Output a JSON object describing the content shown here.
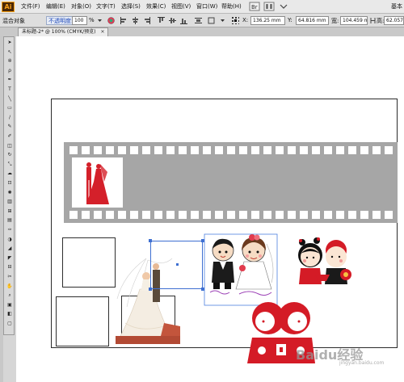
{
  "app": {
    "logo_text": "Ai",
    "brand_color": "#f7a11a"
  },
  "menu": {
    "items": [
      {
        "label": "文件(F)"
      },
      {
        "label": "编辑(E)"
      },
      {
        "label": "对象(O)"
      },
      {
        "label": "文字(T)"
      },
      {
        "label": "选择(S)"
      },
      {
        "label": "效果(C)"
      },
      {
        "label": "视图(V)"
      },
      {
        "label": "窗口(W)"
      },
      {
        "label": "帮助(H)"
      }
    ],
    "right_label": "基本"
  },
  "control_bar": {
    "group_label": "混合对象",
    "opacity_label": "不透明度:",
    "opacity_value": "100",
    "opacity_unit": "%",
    "x_label": "X:",
    "x_value": "136.25 mm",
    "y_label": "Y:",
    "y_value": "64.816 mm",
    "w_label": "宽:",
    "w_value": "104.459 m",
    "h_label": "高:",
    "h_value": "62.057 mm"
  },
  "document": {
    "tab_label": "未标题-2* @ 100% (CMYK/预览)"
  },
  "toolbox": {
    "tools": [
      {
        "name": "selection-tool-icon",
        "glyph": "➤"
      },
      {
        "name": "direct-selection-tool-icon",
        "glyph": "↖"
      },
      {
        "name": "magic-wand-tool-icon",
        "glyph": "✲"
      },
      {
        "name": "lasso-tool-icon",
        "glyph": "ρ"
      },
      {
        "name": "pen-tool-icon",
        "glyph": "✒"
      },
      {
        "name": "type-tool-icon",
        "glyph": "T"
      },
      {
        "name": "line-tool-icon",
        "glyph": "╲"
      },
      {
        "name": "rectangle-tool-icon",
        "glyph": "▭"
      },
      {
        "name": "paintbrush-tool-icon",
        "glyph": "∕"
      },
      {
        "name": "pencil-tool-icon",
        "glyph": "✎"
      },
      {
        "name": "blob-brush-tool-icon",
        "glyph": "✐"
      },
      {
        "name": "eraser-tool-icon",
        "glyph": "◫"
      },
      {
        "name": "rotate-tool-icon",
        "glyph": "↻"
      },
      {
        "name": "scale-tool-icon",
        "glyph": "⤡"
      },
      {
        "name": "warp-tool-icon",
        "glyph": "☁"
      },
      {
        "name": "free-transform-tool-icon",
        "glyph": "⊡"
      },
      {
        "name": "symbol-sprayer-tool-icon",
        "glyph": "✺"
      },
      {
        "name": "graph-tool-icon",
        "glyph": "▥"
      },
      {
        "name": "mesh-tool-icon",
        "glyph": "⊞"
      },
      {
        "name": "gradient-tool-icon",
        "glyph": "▤"
      },
      {
        "name": "eyedropper-tool-icon",
        "glyph": "✑"
      },
      {
        "name": "blend-tool-icon",
        "glyph": "◑"
      },
      {
        "name": "live-paint-bucket-tool-icon",
        "glyph": "◢"
      },
      {
        "name": "live-paint-selection-tool-icon",
        "glyph": "◤"
      },
      {
        "name": "artboard-tool-icon",
        "glyph": "⊟"
      },
      {
        "name": "slice-tool-icon",
        "glyph": "✂"
      },
      {
        "name": "hand-tool-icon",
        "glyph": "✋"
      },
      {
        "name": "zoom-tool-icon",
        "glyph": "⌕"
      },
      {
        "name": "fill-stroke-swatch-icon",
        "glyph": "▣"
      },
      {
        "name": "color-mode-icon",
        "glyph": "◧"
      },
      {
        "name": "screen-mode-icon",
        "glyph": "▢"
      }
    ]
  },
  "watermark": {
    "text": "Baidu经验",
    "sub": "jingyan.baidu.com"
  }
}
